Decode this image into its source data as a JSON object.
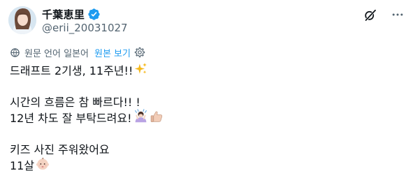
{
  "author": {
    "display_name": "千葉恵里",
    "handle": "@erii_20031027",
    "avatar_icon": "profile-photo",
    "verified_icon": "verified-badge-icon",
    "verified_color": "#1d9bf0"
  },
  "header_icons": {
    "grok_icon": "grok-icon",
    "more_icon": "more-options-icon"
  },
  "translation_bar": {
    "icon": "translate-globe-icon",
    "label": "원문 언어 일본어",
    "show_original": "원본 보기",
    "settings_icon": "gear-icon",
    "accent_color": "#1d9bf0"
  },
  "post": {
    "line1": "드래프트 2기생, 11주년!!",
    "line2": "시간의 흐름은 참 빠르다!! !",
    "line3": "12년 차도 잘 부탁드려요!",
    "line4": "키즈 사진 주워왔어요",
    "line5": "11살",
    "emojis": [
      "sparkles-emoji",
      "person-bowing-emoji",
      "thumbs-up-emoji",
      "baby-emoji"
    ]
  }
}
